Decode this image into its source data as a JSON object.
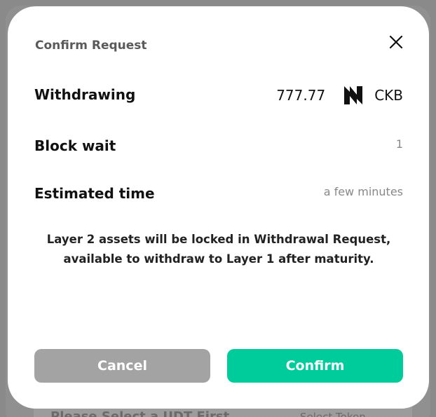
{
  "background": {
    "select_placeholder": "Please Select a UDT First",
    "select_token_label": "Select Token"
  },
  "modal": {
    "title": "Confirm Request",
    "rows": [
      {
        "label": "Withdrawing",
        "amount": "777.77",
        "token": "CKB",
        "token_icon": "nervos-logo-icon"
      },
      {
        "label": "Block wait",
        "value": "1"
      },
      {
        "label": "Estimated time",
        "value": "a few minutes"
      }
    ],
    "notice": "Layer 2 assets will be locked in Withdrawal Request, available to withdraw to Layer 1 after maturity.",
    "buttons": {
      "cancel": "Cancel",
      "confirm": "Confirm"
    }
  },
  "colors": {
    "confirm_bg": "#00cc9b",
    "cancel_bg": "#a3a3a3",
    "overlay": "#8a8a8a"
  }
}
